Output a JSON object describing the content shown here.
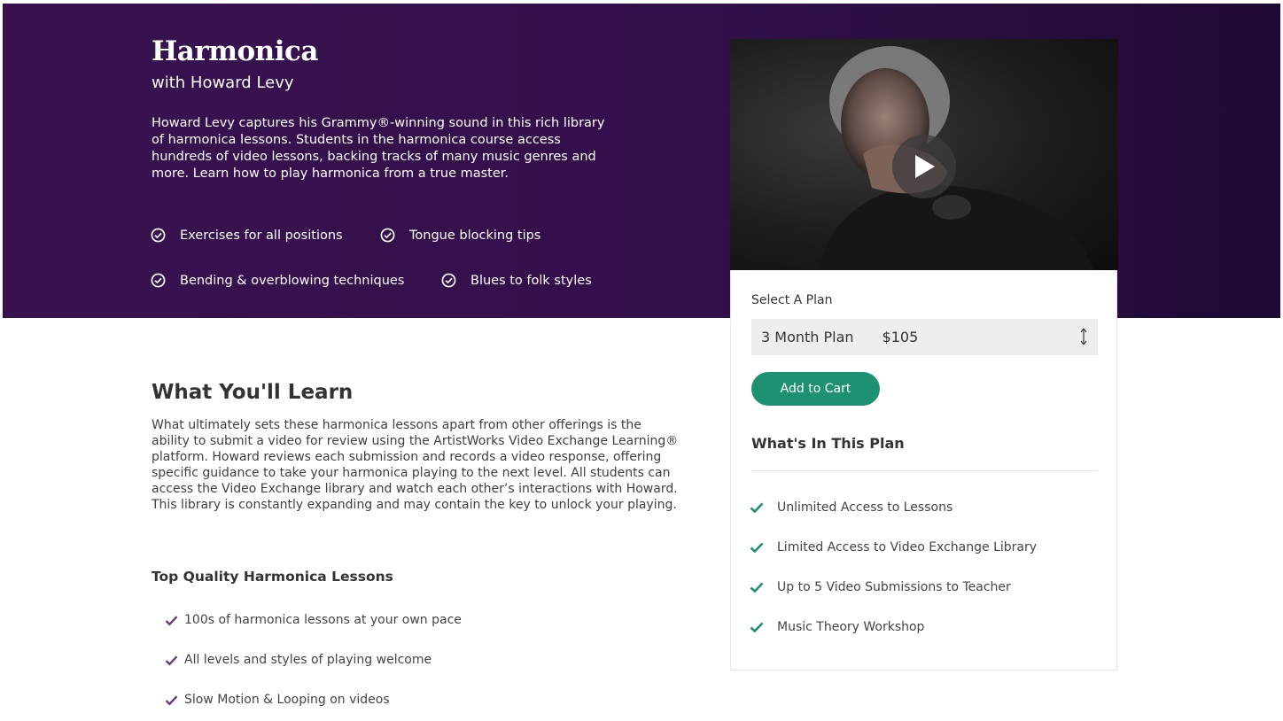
{
  "hero": {
    "title": "Harmonica",
    "subtitle": "with Howard Levy",
    "description": "Howard Levy captures his Grammy®-winning sound in this rich library of harmonica lessons. Students in the harmonica course access hundreds of video lessons, backing tracks of many music genres and more. Learn how to play harmonica from a true master.",
    "features": [
      "Exercises for all positions",
      "Tongue blocking tips",
      "Bending & overblowing techniques",
      "Blues to folk styles"
    ]
  },
  "video": {
    "play_icon": "play-icon",
    "description_image": "instructor-playing-harmonica"
  },
  "plan": {
    "label": "Select A Plan",
    "selected_plan": "3 Month Plan",
    "selected_price": "$105",
    "add_to_cart": "Add to Cart",
    "heading": "What's In This Plan",
    "items": [
      "Unlimited Access to Lessons",
      "Limited Access to Video Exchange Library",
      "Up to 5 Video Submissions to Teacher",
      "Music Theory Workshop"
    ]
  },
  "learn": {
    "title": "What You'll Learn",
    "body": "What ultimately sets these harmonica lessons apart from other offerings is the ability to submit a video for review using the ArtistWorks Video Exchange Learning® platform. Howard reviews each submission and records a video response, offering specific guidance to take your harmonica playing to the next level. All students can access the Video Exchange library and watch each other’s interactions with Howard. This library is constantly expanding and may contain the key to unlock your playing.",
    "quality_title": "Top Quality Harmonica Lessons",
    "quality_items": [
      "100s of harmonica lessons at your own pace",
      "All levels and styles of playing welcome",
      "Slow Motion & Looping on videos"
    ]
  },
  "colors": {
    "hero_bg": "#38124f",
    "accent_green": "#1f9173",
    "check_purple": "#6b3a80"
  }
}
